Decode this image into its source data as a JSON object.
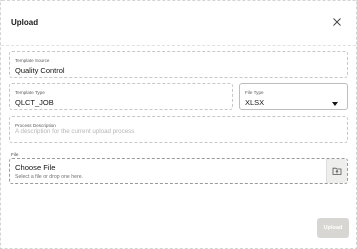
{
  "dialog": {
    "title": "Upload",
    "close_icon": "close-icon"
  },
  "template_source": {
    "label": "Template Source",
    "value": "Quality Control"
  },
  "template_type": {
    "label": "Template Type",
    "value": "QLCT_JOB"
  },
  "file_type": {
    "label": "File Type",
    "value": "XLSX",
    "icon": "chevron-down-icon"
  },
  "process_description": {
    "label": "Process Description",
    "placeholder": "A description for the current upload process"
  },
  "file": {
    "label": "File",
    "title": "Choose File",
    "hint": "Select a file or drop one here.",
    "icon": "folder-upload-icon"
  },
  "actions": {
    "upload_label": "Upload"
  }
}
